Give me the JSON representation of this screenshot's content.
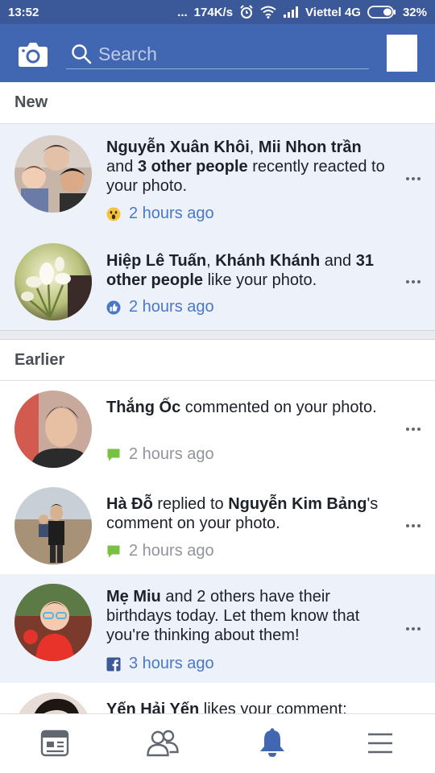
{
  "status_bar": {
    "time": "13:52",
    "dots": "...",
    "speed": "174K/s",
    "carrier": "Viettel 4G",
    "battery": "32%"
  },
  "header": {
    "search_placeholder": "Search"
  },
  "sections": {
    "new_label": "New",
    "earlier_label": "Earlier"
  },
  "notifications": [
    {
      "actor1": "Nguyễn Xuân Khôi",
      "sep1": ", ",
      "actor2": "Mii Nhon trần",
      "mid1": " and ",
      "actor3": "3 other people",
      "tail": " recently reacted to your photo.",
      "time": "2 hours ago",
      "icon": "wow-reaction-icon"
    },
    {
      "actor1": "Hiệp Lê Tuấn",
      "sep1": ", ",
      "actor2": "Khánh Khánh",
      "mid1": " and ",
      "actor3": "31 other people",
      "tail": " like your photo.",
      "time": "2 hours ago",
      "icon": "like-reaction-icon"
    },
    {
      "actor1": "Thắng Ốc",
      "tail": " commented on your photo.",
      "time": "2 hours ago",
      "icon": "comment-icon"
    },
    {
      "actor1": "Hà Đỗ",
      "mid1": " replied to ",
      "actor2": "Nguyễn Kim Bảng",
      "tail": "'s comment on your photo.",
      "time": "2 hours ago",
      "icon": "comment-icon"
    },
    {
      "actor1": "Mẹ Miu",
      "tail": " and 2 others have their birthdays today. Let them know that you're thinking about them!",
      "time": "3 hours ago",
      "icon": "facebook-icon"
    },
    {
      "actor1": "Yến Hải Yến",
      "tail": " likes your comment:"
    }
  ],
  "colors": {
    "brand_blue": "#4267b2",
    "status_blue": "#3b5998",
    "unread_bg": "#edf2fa",
    "link_blue": "#4a78c7",
    "comment_green": "#7ac143"
  }
}
